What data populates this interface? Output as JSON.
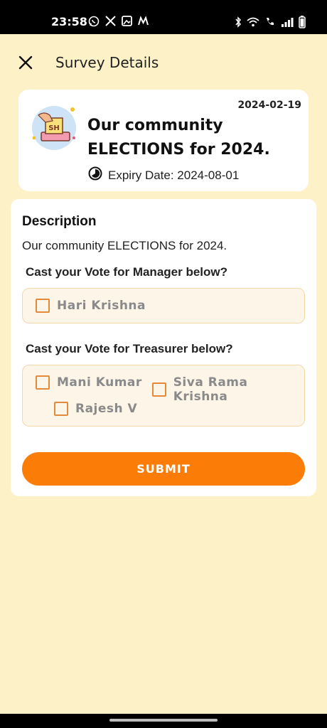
{
  "status_bar": {
    "time": "23:58",
    "left_icons": [
      "whatsapp-icon",
      "x-icon",
      "gallery-icon",
      "m-app-icon"
    ],
    "right_icons": [
      "bluetooth-icon",
      "wifi-icon",
      "wifi-calling-icon",
      "signal-icon",
      "battery-icon"
    ]
  },
  "header": {
    "title": "Survey Details",
    "close_icon": "close-icon"
  },
  "survey": {
    "date": "2024-02-19",
    "title": "Our community ELECTIONS for 2024.",
    "expiry": "Expiry Date: 2024-08-01",
    "icon": "ballot-box-icon"
  },
  "details": {
    "description_heading": "Description",
    "description_text": "Our community ELECTIONS for 2024.",
    "questions": [
      {
        "label": "Cast your Vote for Manager below?",
        "options": [
          "Hari Krishna"
        ]
      },
      {
        "label": "Cast your Vote for Treasurer below?",
        "options": [
          "Mani Kumar",
          "Siva Rama Krishna",
          "Rajesh V"
        ]
      }
    ],
    "submit_label": "SUBMIT"
  },
  "colors": {
    "background": "#fdf2c7",
    "accent": "#fb7c06",
    "checkbox": "#e58a3a",
    "option_bg": "#fdf5e8"
  }
}
